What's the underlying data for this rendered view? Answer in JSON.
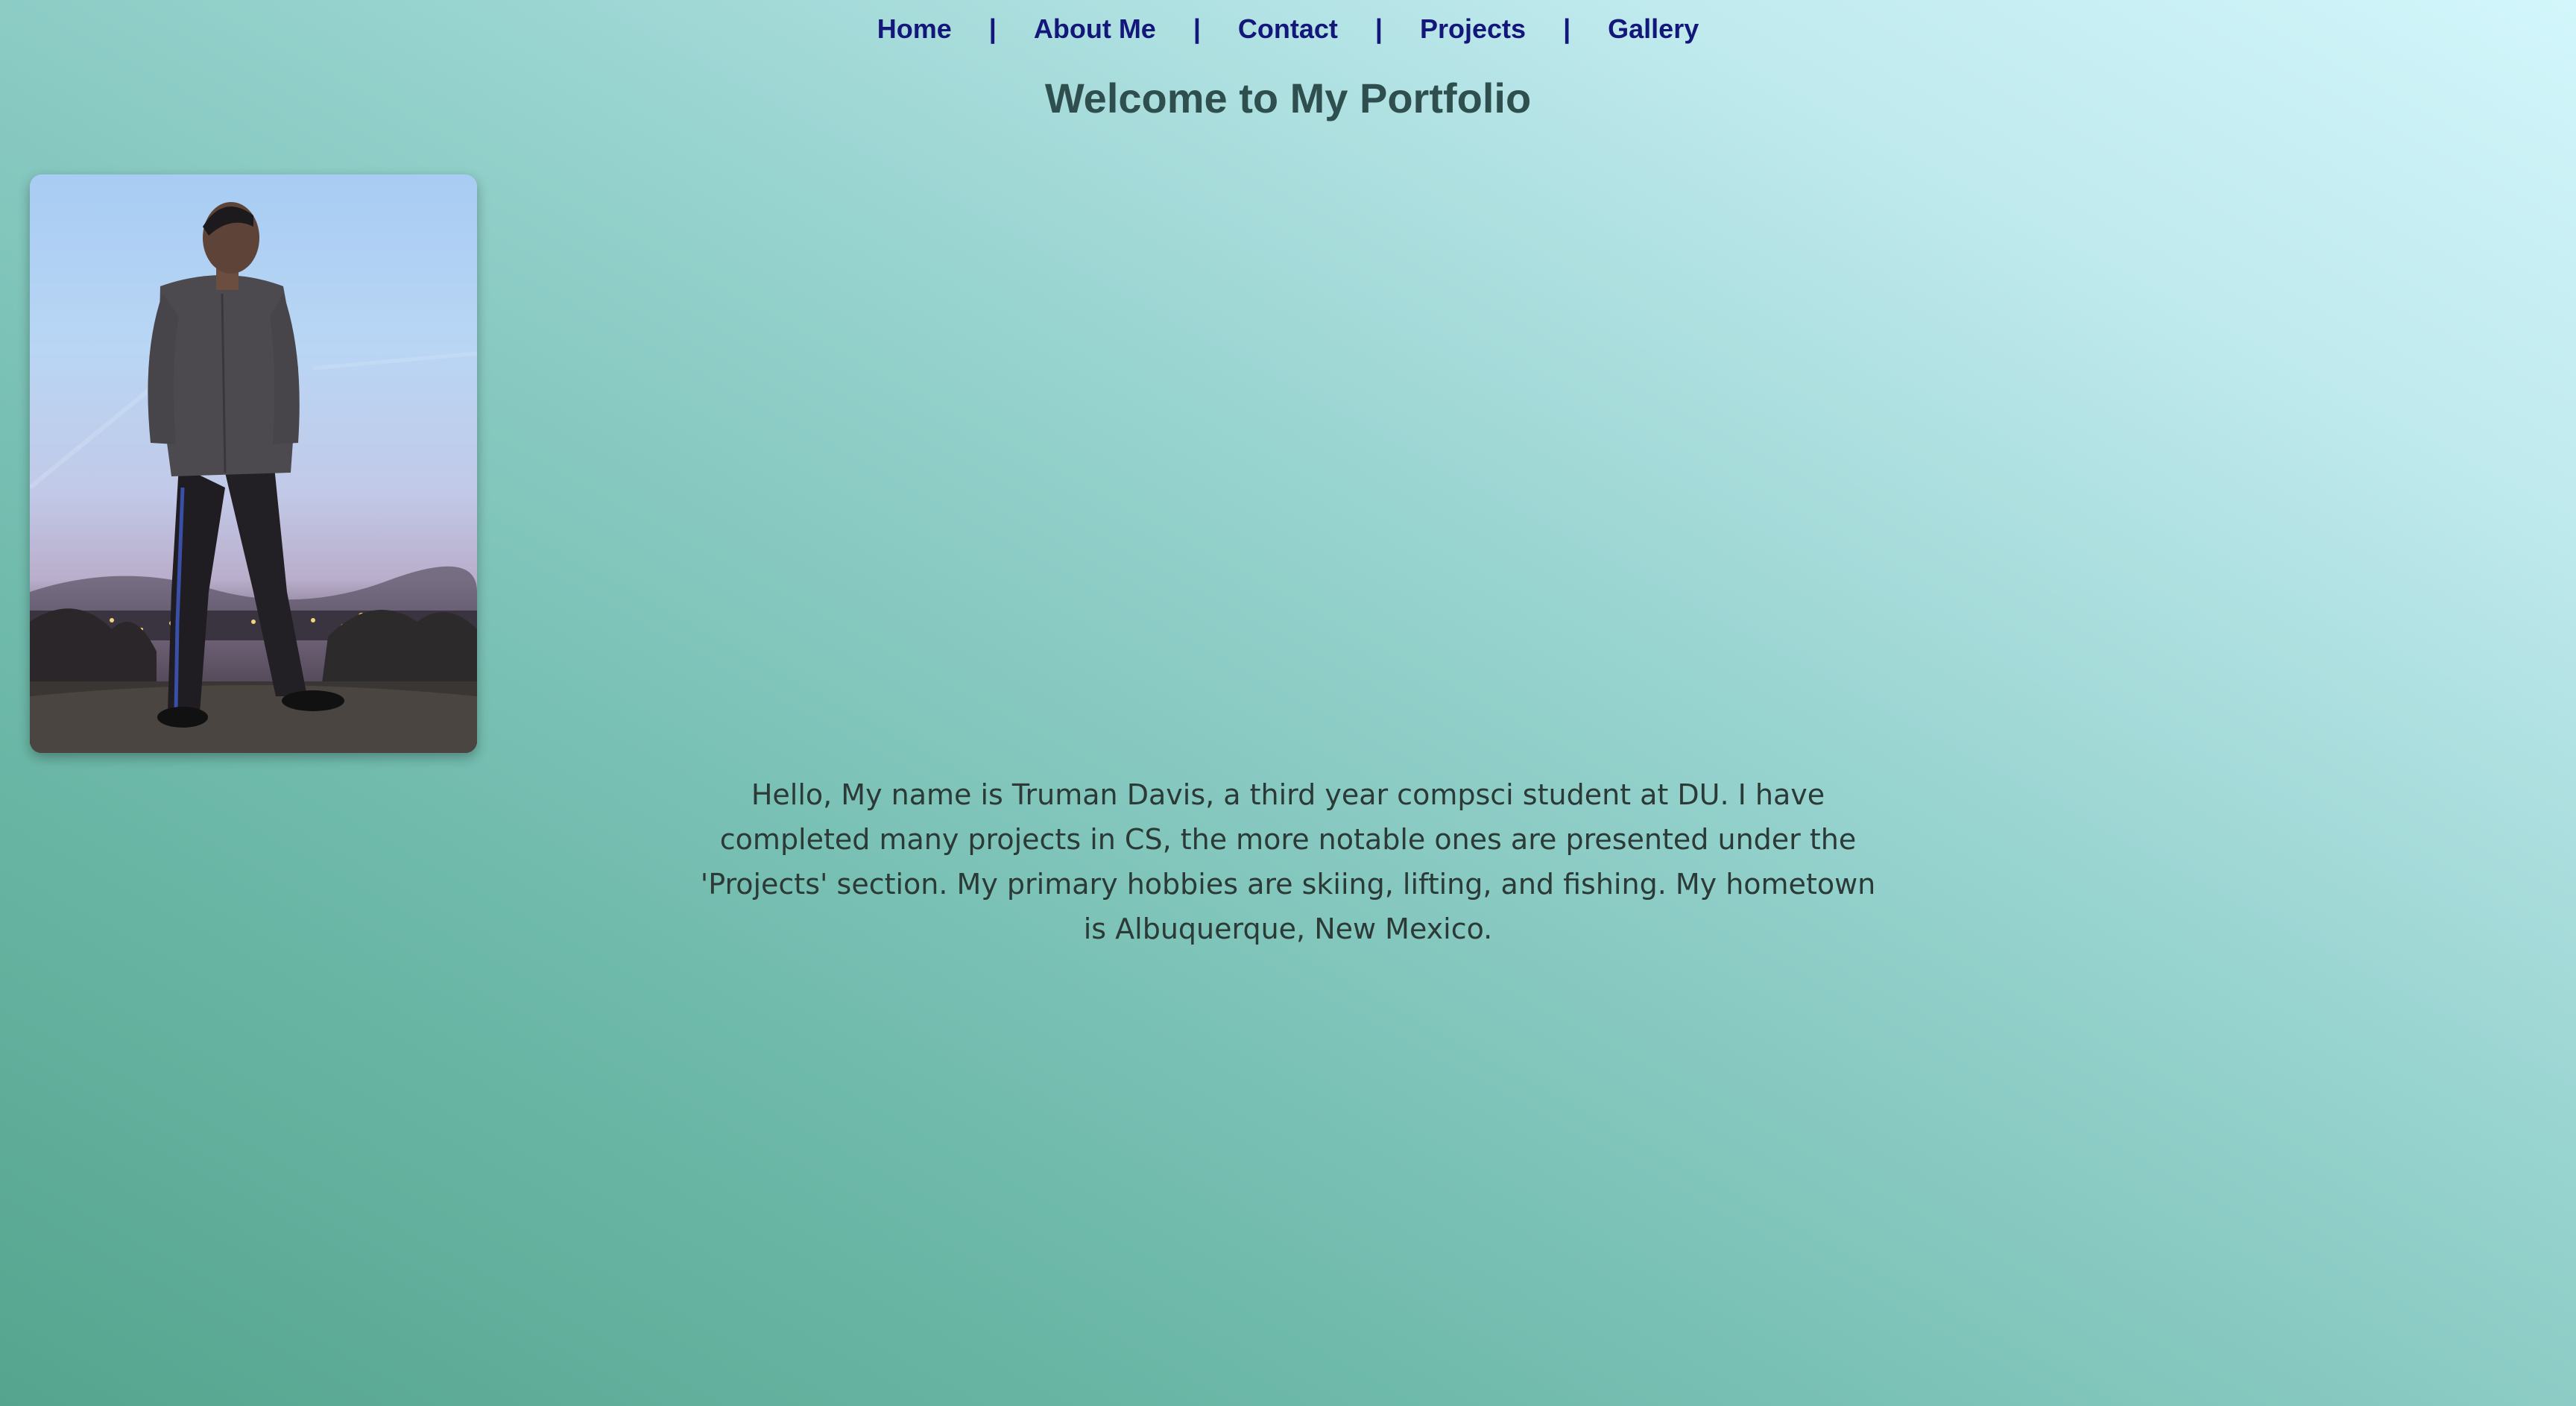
{
  "nav": {
    "items": [
      {
        "label": "Home"
      },
      {
        "label": "About Me"
      },
      {
        "label": "Contact"
      },
      {
        "label": "Projects"
      },
      {
        "label": "Gallery"
      }
    ],
    "separator": "|"
  },
  "page": {
    "title": "Welcome to My Portfolio"
  },
  "profile": {
    "photo_icon": "person-photo"
  },
  "bio": {
    "text": "Hello, My name is Truman Davis, a third year compsci student at DU. I have completed many projects in CS, the more notable ones are presented under the 'Projects' section. My primary hobbies are skiing, lifting, and fishing. My hometown is Albuquerque, New Mexico."
  },
  "colors": {
    "nav_link": "#14177a",
    "title": "#2f4f4f",
    "body_text": "#2b3a36",
    "gradient_start": "#55a58e",
    "gradient_end": "#d2f6fb"
  }
}
